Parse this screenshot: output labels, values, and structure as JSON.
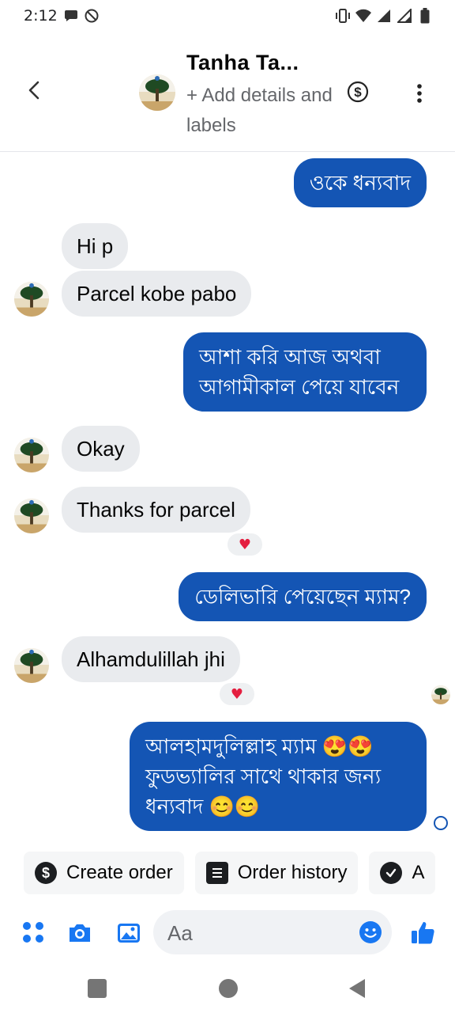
{
  "status_bar": {
    "time": "2:12"
  },
  "header": {
    "contact_name": "Tanha Ta...",
    "subtitle": "+ Add details and labels"
  },
  "messages": [
    {
      "id": "m1",
      "direction": "outgoing",
      "text": "ওকে ধন্যবাদ"
    },
    {
      "id": "m2",
      "direction": "incoming",
      "text": "Hi p"
    },
    {
      "id": "m3",
      "direction": "incoming",
      "text": "Parcel kobe pabo"
    },
    {
      "id": "m4",
      "direction": "outgoing",
      "text": "আশা করি আজ অথবা আগামীকাল পেয়ে যাবেন"
    },
    {
      "id": "m5",
      "direction": "incoming",
      "text": "Okay"
    },
    {
      "id": "m6",
      "direction": "incoming",
      "text": "Thanks for parcel",
      "reaction": "♥"
    },
    {
      "id": "m7",
      "direction": "outgoing",
      "text": "ডেলিভারি পেয়েছেন ম্যাম?"
    },
    {
      "id": "m8",
      "direction": "incoming",
      "text": "Alhamdulillah jhi",
      "reaction": "♥"
    },
    {
      "id": "m9",
      "direction": "outgoing",
      "text": "আলহামদুলিল্লাহ ম্যাম 😍😍 ফুডভ্যালির সাথে থাকার জন্য ধন্যবাদ 😊😊"
    }
  ],
  "quick_actions": [
    {
      "label": "Create order",
      "icon": "dollar-circle-icon"
    },
    {
      "label": "Order history",
      "icon": "receipt-icon"
    },
    {
      "label": "A",
      "icon": "check-circle-icon"
    }
  ],
  "composer": {
    "placeholder": "Aa"
  },
  "colors": {
    "outgoing_bubble": "#1455b4",
    "incoming_bubble": "#e9ebee",
    "accent": "#1877f2",
    "reaction_heart": "#e41e3f"
  }
}
